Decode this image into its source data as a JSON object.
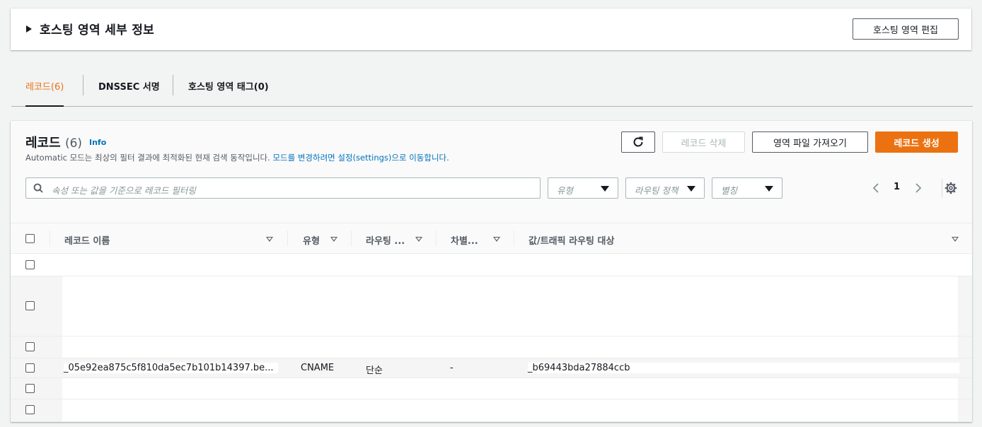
{
  "hosted_zone": {
    "title": "호스팅 영역 세부 정보",
    "edit_button": "호스팅 영역 편집"
  },
  "tabs": [
    {
      "label": "레코드(6)"
    },
    {
      "label": "DNSSEC 서명"
    },
    {
      "label": "호스팅 영역 태그(0)"
    }
  ],
  "records": {
    "title": "레코드",
    "count": "(6)",
    "info": "Info",
    "description": "Automatic 모드는 최상의 필터 결과에 최적화된 현재 검색 동작입니다.",
    "description_link": "모드를 변경하려면 설정(settings)으로 이동합니다.",
    "delete_button": "레코드 삭제",
    "import_button": "영역 파일 가져오기",
    "create_button": "레코드 생성",
    "search_placeholder": "속성 또는 값을 기준으로 레코드 필터링",
    "filter_type": "유형",
    "filter_routing": "라우팅 정책",
    "filter_alias": "별칭",
    "page_number": "1",
    "colors": {
      "accent": "#ec7211",
      "link": "#0073bb"
    }
  },
  "table": {
    "columns": [
      "레코드 이름",
      "유형",
      "라우팅 ...",
      "차별...",
      "값/트래픽 라우팅 대상"
    ],
    "rows": [
      {
        "name": "",
        "type": "",
        "routing": "",
        "diff": "",
        "value": ""
      },
      {
        "name": "",
        "type": "",
        "routing": "",
        "diff": "",
        "value": ""
      },
      {
        "name": "",
        "type": "",
        "routing": "",
        "diff": "",
        "value": ""
      },
      {
        "name": "_05e92ea875c5f810da5ec7b101b14397.be...",
        "type": "CNAME",
        "routing": "단순",
        "diff": "-",
        "value": "_b69443bda27884ccb"
      },
      {
        "name": "",
        "type": "",
        "routing": "",
        "diff": "",
        "value": ""
      },
      {
        "name": "",
        "type": "",
        "routing": "",
        "diff": "",
        "value": ""
      }
    ]
  }
}
